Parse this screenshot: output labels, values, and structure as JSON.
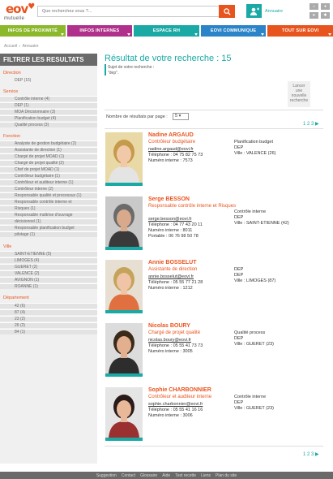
{
  "logo": {
    "sub": "mutuelle"
  },
  "search": {
    "placeholder": "Que recherchez vous ?..."
  },
  "header": {
    "annuaire": "Annuaire"
  },
  "nav": [
    {
      "label": "INFOS DE PROXIMITÉ",
      "color": "#8cb82b"
    },
    {
      "label": "INFOS INTERNES",
      "color": "#b0318b"
    },
    {
      "label": "ESPACE RH",
      "color": "#1aa9a5"
    },
    {
      "label": "EOVI COMMUNIQUE",
      "color": "#2b84c7"
    },
    {
      "label": "TOUT SUR EOVI",
      "color": "#e8541e"
    }
  ],
  "breadcrumb": {
    "home": "Accueil",
    "current": "Annuaire"
  },
  "sidebar": {
    "title": "FILTRER LES RESULTATS",
    "groups": [
      {
        "title": "Direction",
        "items": [
          "DEP  (15)"
        ]
      },
      {
        "title": "Service",
        "items": [
          "Contrôle interne  (4)",
          "DEP  (1)",
          "MOA Décisionnaire  (3)",
          "Planification budget  (4)",
          "Qualité process  (3)"
        ]
      },
      {
        "title": "Fonction",
        "items": [
          "Analyste de gestion budgétaire  (2)",
          "Assistante de direction  (1)",
          "Chargé de projet MOAD  (1)",
          "Chargé de projet qualité  (2)",
          "Chef de projet MOAD  (1)",
          "Contrôleur budgétaire  (1)",
          "Contrôleur et auditeur interne  (1)",
          "Contrôleur interne  (2)",
          "Responsable qualité et processus  (1)",
          "Responsable contrôle interne et",
          "Risques  (1)",
          "Responsable maîtrise d'ouvrage",
          "décisionnel  (1)",
          "Responsable planification budget",
          "pilotage  (1)"
        ]
      },
      {
        "title": "Ville",
        "items": [
          "SAINT-ETIENNE  (5)",
          "LIMOGES  (4)",
          "GUERET  (2)",
          "VALENCE  (2)",
          "AVIGNON  (1)",
          "ROANNE  (1)"
        ]
      },
      {
        "title": "Département",
        "items": [
          "42  (6)",
          "87  (4)",
          "23  (2)",
          "26  (2)",
          "84  (1)"
        ]
      }
    ]
  },
  "results": {
    "title": "Résultat de votre recherche : 15",
    "sub_label": "Sujet de votre recherche :",
    "query": "\"dep\".",
    "new_search": "Lancer une nouvelle recherche",
    "perpage_label": "Nombre de résultats par page :",
    "perpage_value": "5",
    "pages": "1 2 3 ▶"
  },
  "people": [
    {
      "name": "Nadine ARGAUD",
      "role": "Contrôleur budgétaire",
      "email": "nadine.argaud@eovi.fr",
      "tel": "Téléphone : 04 75 82 75 73",
      "internal": "Numéro interne : 7573",
      "portable": "",
      "service": "Planification budget",
      "direction": "DEP",
      "ville": "Ville : VALENCE (26)"
    },
    {
      "name": "Serge BESSON",
      "role": "Responsable contrôle interne et Risques",
      "email": "serge.besson@eovi.fr",
      "tel": "Téléphone : 04 77 43 20 11",
      "internal": "Numéro interne : 8011",
      "portable": "Portable : 06 76 98 50 78",
      "service": "Contrôle interne",
      "direction": "DEP",
      "ville": "Ville : SAINT-ETIENNE (42)"
    },
    {
      "name": "Annie BOSSELUT",
      "role": "Assistante de direction",
      "email": "annie.bosselut@eovi.fr",
      "tel": "Téléphone : 05 55 77 21 28",
      "internal": "Numéro interne : 1212",
      "portable": "",
      "service": "DEP",
      "direction": "DEP",
      "ville": "Ville : LIMOGES (87)"
    },
    {
      "name": "Nicolas BOURY",
      "role": "Chargé de projet qualité",
      "email": "nicolas.boury@eovi.fr",
      "tel": "Téléphone : 05 55 41 73 73",
      "internal": "Numéro interne : 3005",
      "portable": "",
      "service": "Qualité process",
      "direction": "DEP",
      "ville": "Ville : GUERET (23)"
    },
    {
      "name": "Sophie CHARBONNIER",
      "role": "Contrôleur et auditeur interne",
      "email": "sophie.charbonnier@eovi.fr",
      "tel": "Téléphone : 05 55 41 16 16",
      "internal": "Numéro interne : 3006",
      "portable": "",
      "service": "Contrôle interne",
      "direction": "DEP",
      "ville": "Ville : GUERET (23)"
    }
  ],
  "footer": [
    "Suggestion",
    "Contact",
    "Glossaire",
    "Aide",
    "Test recette",
    "Liens",
    "Plan du site"
  ]
}
